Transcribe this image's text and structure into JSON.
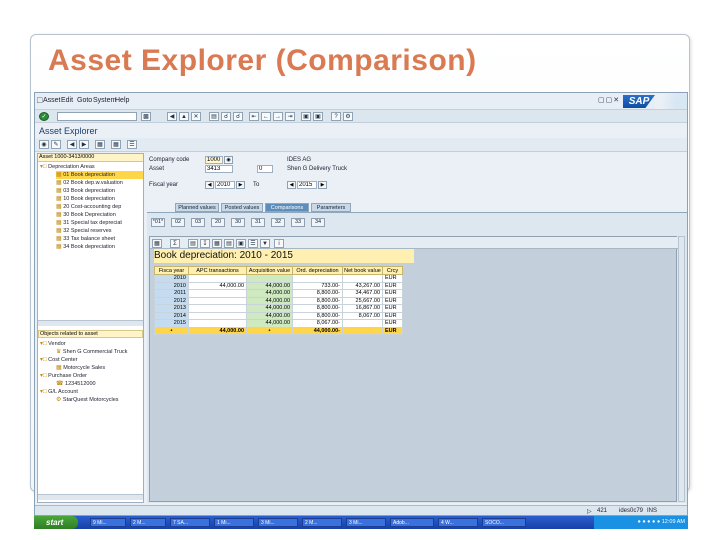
{
  "slide": {
    "title": "Asset Explorer (Comparison)"
  },
  "menu": {
    "items": [
      "Asset",
      "Edit",
      "Goto",
      "System",
      "Help"
    ]
  },
  "app": {
    "title": "Asset Explorer"
  },
  "tree": {
    "header": "Asset 1000-3413/0000",
    "items": [
      {
        "label": "Depreciation Areas",
        "selected": false
      },
      {
        "label": "01 Book depreciation",
        "selected": true
      },
      {
        "label": "02 Book dep.w.valuation",
        "selected": false
      },
      {
        "label": "03 Book depreciation",
        "selected": false
      },
      {
        "label": "10 Book depreciation",
        "selected": false
      },
      {
        "label": "20 Cost-accounting dep",
        "selected": false
      },
      {
        "label": "30 Book Depreciation",
        "selected": false
      },
      {
        "label": "31 Special tax depreciat",
        "selected": false
      },
      {
        "label": "32 Special reserves",
        "selected": false
      },
      {
        "label": "33 Tax balance sheet",
        "selected": false
      },
      {
        "label": "34 Book depreciation",
        "selected": false
      }
    ],
    "related_header": "Objects related to asset",
    "related": [
      {
        "label": "Vendor",
        "indent": 0
      },
      {
        "label": "Shen G Commercial Truck",
        "indent": 1
      },
      {
        "label": "Cost Center",
        "indent": 0
      },
      {
        "label": "Motorcycle Sales",
        "indent": 1
      },
      {
        "label": "Purchase Order",
        "indent": 0
      },
      {
        "label": "1234512000",
        "indent": 1
      },
      {
        "label": "G/L Account",
        "indent": 0
      },
      {
        "label": "StarQuest Motorcycles",
        "indent": 1
      }
    ]
  },
  "form": {
    "company_code_label": "Company code",
    "company_code_value": "1000",
    "company_code_text": "IDES AG",
    "asset_label": "Asset",
    "asset_value": "3413",
    "asset_sub": "0",
    "asset_text": "Shen G Delivery Truck",
    "fiscal_year_label": "Fiscal year",
    "fiscal_year_from": "2010",
    "to_label": "To",
    "fiscal_year_to": "2015"
  },
  "tabs": [
    {
      "label": "Planned values",
      "active": false
    },
    {
      "label": "Posted values",
      "active": false
    },
    {
      "label": "Comparisons",
      "active": true
    },
    {
      "label": "Parameters",
      "active": false
    }
  ],
  "area_buttons": [
    "*01*",
    "02",
    "03",
    "20",
    "30",
    "31",
    "32",
    "33",
    "34"
  ],
  "grid": {
    "title": "Book depreciation: 2010 - 2015",
    "columns": [
      "Fisca year",
      "APC transactions",
      "Acquisition value",
      "Ord. depreciation",
      "Net book value",
      "Crcy"
    ],
    "rows": [
      [
        "2010",
        "",
        "",
        "",
        "",
        "EUR"
      ],
      [
        "2010",
        "44,000.00",
        "44,000.00",
        "733.00-",
        "43,267.00",
        "EUR"
      ],
      [
        "2011",
        "",
        "44,000.00",
        "8,800.00-",
        "34,467.00",
        "EUR"
      ],
      [
        "2012",
        "",
        "44,000.00",
        "8,800.00-",
        "25,667.00",
        "EUR"
      ],
      [
        "2013",
        "",
        "44,000.00",
        "8,800.00-",
        "16,867.00",
        "EUR"
      ],
      [
        "2014",
        "",
        "44,000.00",
        "8,800.00-",
        "8,067.00",
        "EUR"
      ],
      [
        "2015",
        "",
        "44,000.00",
        "8,067.00-",
        "",
        "EUR"
      ]
    ],
    "total_row": [
      "",
      "44,000.00",
      "",
      "44,000.00-",
      "",
      "EUR"
    ],
    "total_marker": "•"
  },
  "status": {
    "session": "421",
    "server": "ides0c79",
    "mode": "INS"
  },
  "taskbar": {
    "start_label": "start",
    "items": [
      "9 Mi...",
      "2 M...",
      "7 SA...",
      "1 Mi...",
      "3 Mi...",
      "2 M...",
      "3 Mi...",
      "Adob...",
      "4 W...",
      "SOCO..."
    ],
    "clock": "12:09 AM"
  },
  "colors": {
    "title": "#d97a52",
    "selected": "#ffd54a",
    "tab_active": "#5d8dbb"
  }
}
